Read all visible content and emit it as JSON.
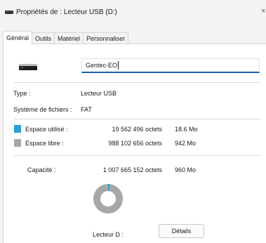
{
  "window": {
    "title": "Propriétés de : Lecteur USB (D:)",
    "close_glyph": "×"
  },
  "tabs": [
    {
      "label": "Général",
      "active": true
    },
    {
      "label": "Outils",
      "active": false
    },
    {
      "label": "Matériel",
      "active": false
    },
    {
      "label": "Personnaliser",
      "active": false
    }
  ],
  "general": {
    "drive_icon": "usb-drive-icon",
    "volume_name": "Gentec-EO",
    "type_label": "Type :",
    "type_value": "Lecteur USB",
    "fs_label": "Système de fichiers :",
    "fs_value": "FAT",
    "used": {
      "label": "Espace utilisé :",
      "bytes": "19 562 496 octets",
      "size": "18.6 Mo",
      "color": "#26a0da"
    },
    "free": {
      "label": "Espace libre :",
      "bytes": "988 102 656 octets",
      "size": "942 Mo",
      "color": "#a7a7a7"
    },
    "capacity": {
      "label": "Capacité :",
      "bytes": "1 007 665 152 octets",
      "size": "960 Mo"
    },
    "used_fraction": 0.0194,
    "drive_label": "Lecteur D :",
    "details_button": "Détails"
  }
}
